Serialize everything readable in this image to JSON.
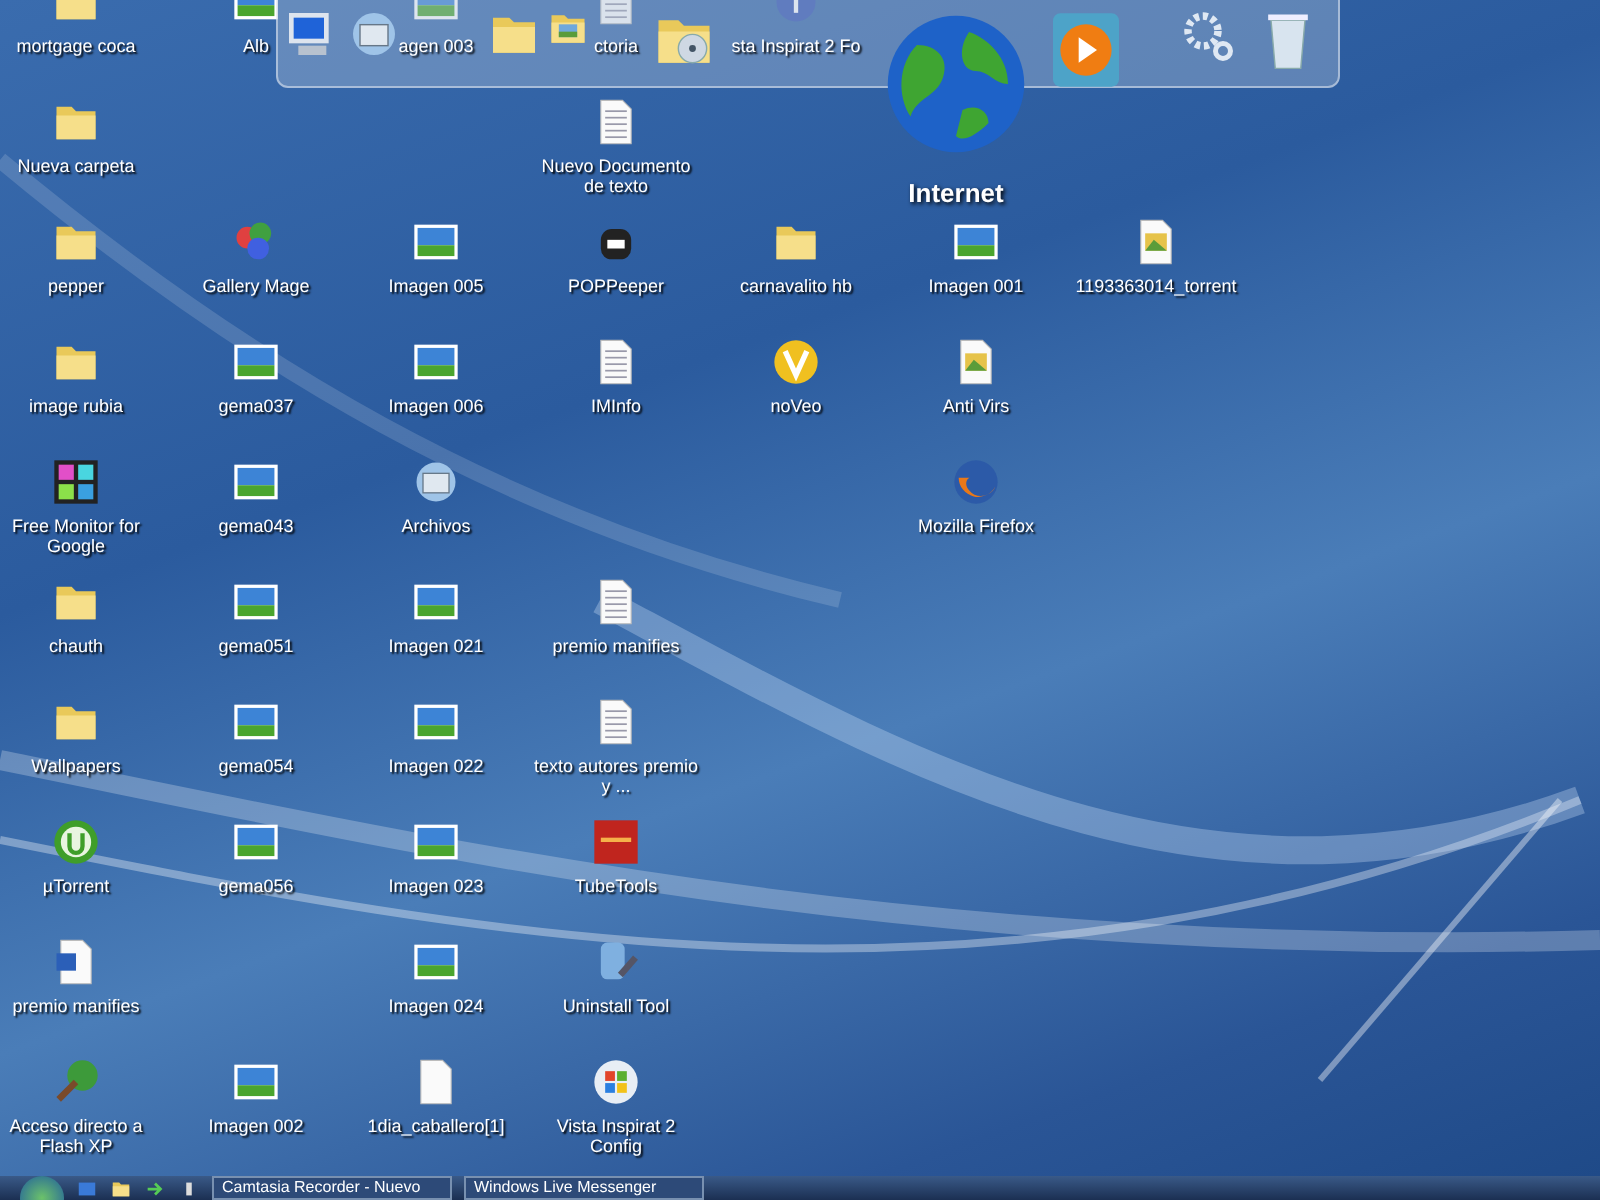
{
  "desktop": {
    "columns": [
      [
        {
          "label": "mortgage coca",
          "kind": "folder"
        },
        {
          "label": "Nueva carpeta",
          "kind": "folder"
        },
        {
          "label": "pepper",
          "kind": "folder"
        },
        {
          "label": "image rubia",
          "kind": "folder"
        },
        {
          "label": "Free Monitor for Google",
          "kind": "grid-app"
        },
        {
          "label": "chauth",
          "kind": "folder"
        },
        {
          "label": "Wallpapers",
          "kind": "folder"
        },
        {
          "label": "µTorrent",
          "kind": "torrent"
        },
        {
          "label": "premio manifies",
          "kind": "word"
        },
        {
          "label": "Acceso directo a Flash XP",
          "kind": "leaf-app"
        }
      ],
      [
        {
          "label": "Alb",
          "kind": "image"
        },
        null,
        {
          "label": "Gallery Mage",
          "kind": "gallery"
        },
        {
          "label": "gema037",
          "kind": "image"
        },
        {
          "label": "gema043",
          "kind": "image"
        },
        {
          "label": "gema051",
          "kind": "image"
        },
        {
          "label": "gema054",
          "kind": "image"
        },
        {
          "label": "gema056",
          "kind": "image"
        },
        null,
        {
          "label": "Imagen 002",
          "kind": "image"
        }
      ],
      [
        {
          "label": "agen 003",
          "kind": "image"
        },
        null,
        {
          "label": "Imagen 005",
          "kind": "image"
        },
        {
          "label": "Imagen 006",
          "kind": "image"
        },
        {
          "label": "Archivos",
          "kind": "network"
        },
        {
          "label": "Imagen 021",
          "kind": "image"
        },
        {
          "label": "Imagen 022",
          "kind": "image"
        },
        {
          "label": "Imagen 023",
          "kind": "image"
        },
        {
          "label": "Imagen 024",
          "kind": "image"
        },
        {
          "label": "1dia_caballero[1]",
          "kind": "blank"
        }
      ],
      [
        {
          "label": "ctoria",
          "kind": "text"
        },
        {
          "label": "Nuevo Documento de texto",
          "kind": "text"
        },
        {
          "label": "POPPeeper",
          "kind": "mailbox"
        },
        {
          "label": "IMInfo",
          "kind": "text"
        },
        null,
        {
          "label": "premio manifies",
          "kind": "text"
        },
        {
          "label": "texto autores premio y ...",
          "kind": "text"
        },
        {
          "label": "TubeTools",
          "kind": "tube"
        },
        {
          "label": "Uninstall Tool",
          "kind": "uninstall"
        },
        {
          "label": "Vista Inspirat 2 Config",
          "kind": "vista"
        }
      ],
      [
        {
          "label": "sta Inspirat 2 Fo",
          "kind": "info"
        },
        null,
        {
          "label": "carnavalito hb",
          "kind": "folder"
        },
        {
          "label": "noVeo",
          "kind": "v-app"
        }
      ],
      [
        null,
        null,
        {
          "label": "Imagen 001",
          "kind": "image"
        },
        {
          "label": "Anti Virs",
          "kind": "picture-doc"
        },
        {
          "label": "Mozilla Firefox",
          "kind": "firefox"
        }
      ],
      [
        null,
        null,
        {
          "label": "1193363014_torrent",
          "kind": "picture-doc"
        }
      ]
    ]
  },
  "dock": {
    "items": [
      {
        "kind": "computer"
      },
      {
        "kind": "network"
      },
      {
        "kind": "folder"
      },
      {
        "kind": "photo-folder"
      },
      {
        "kind": "disc-folder"
      },
      {
        "kind": "globe",
        "label": "Internet"
      },
      {
        "kind": "media"
      },
      {
        "kind": "separator"
      },
      {
        "kind": "gear"
      },
      {
        "kind": "trash"
      }
    ]
  },
  "taskbar": {
    "quick_launch": [
      {
        "kind": "desktop"
      },
      {
        "kind": "folder"
      },
      {
        "kind": "arrow"
      },
      {
        "kind": "pin"
      }
    ],
    "tasks": [
      {
        "label": "Camtasia Recorder - Nuevo"
      },
      {
        "label": "Windows Live Messenger"
      }
    ]
  }
}
